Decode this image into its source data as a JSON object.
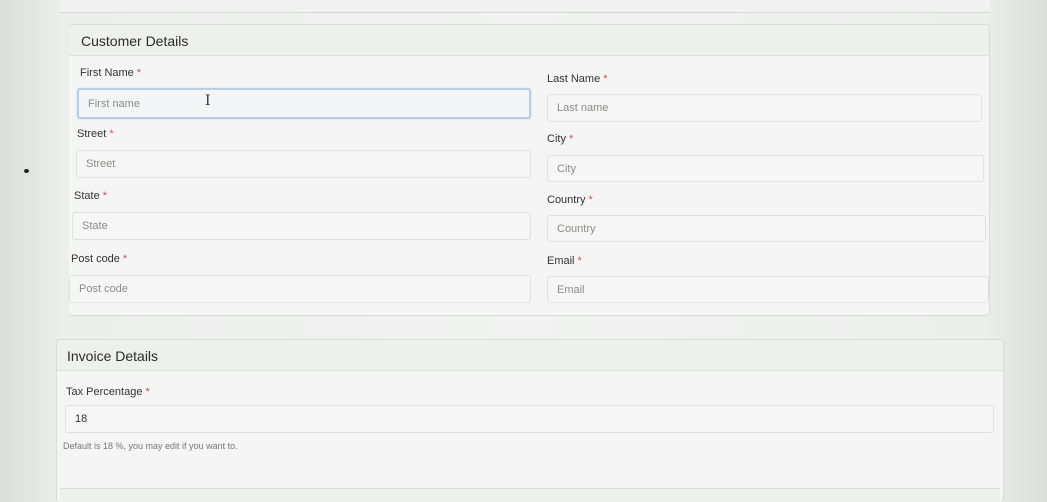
{
  "customer_details": {
    "title": "Customer Details",
    "required_mark": "*",
    "first_name": {
      "label": "First Name",
      "placeholder": "First name",
      "value": ""
    },
    "last_name": {
      "label": "Last Name",
      "placeholder": "Last name",
      "value": ""
    },
    "street": {
      "label": "Street",
      "placeholder": "Street",
      "value": ""
    },
    "city": {
      "label": "City",
      "placeholder": "City",
      "value": ""
    },
    "state": {
      "label": "State",
      "placeholder": "State",
      "value": ""
    },
    "country": {
      "label": "Country",
      "placeholder": "Country",
      "value": ""
    },
    "post_code": {
      "label": "Post code",
      "placeholder": "Post code",
      "value": ""
    },
    "email": {
      "label": "Email",
      "placeholder": "Email",
      "value": ""
    }
  },
  "invoice_details": {
    "title": "Invoice Details",
    "tax_percentage": {
      "label": "Tax Percentage",
      "value": "18"
    },
    "help_text": "Default is 18 %, you may edit if you want to."
  },
  "colors": {
    "required": "#d9534f",
    "focus_border": "#b9cde6"
  },
  "icons": {
    "text_cursor": "I"
  }
}
